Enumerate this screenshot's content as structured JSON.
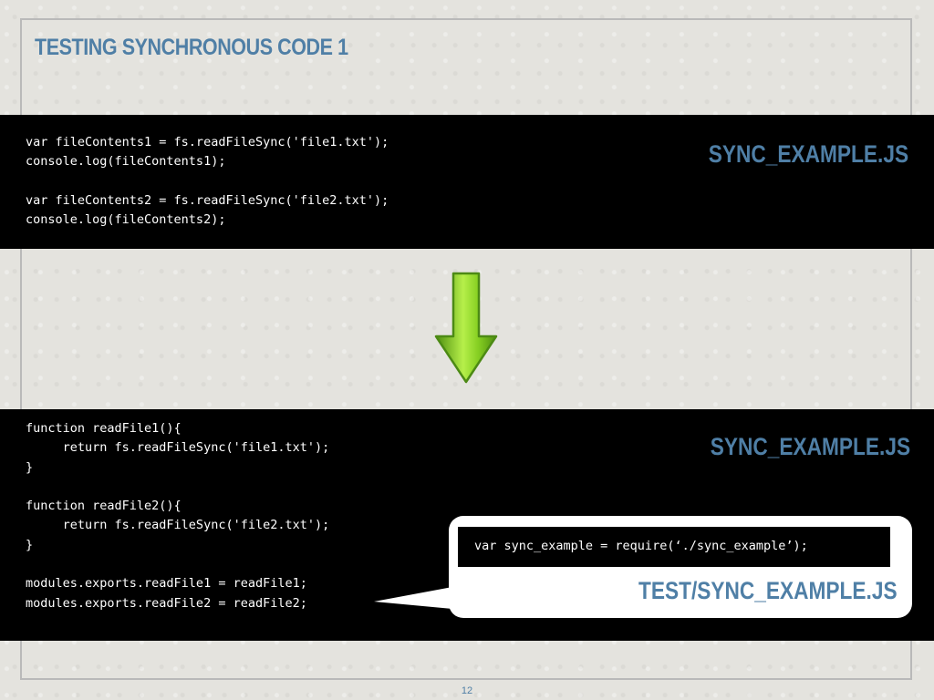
{
  "slide": {
    "title": "TESTING SYNCHRONOUS CODE 1",
    "page_number": "12"
  },
  "top_panel": {
    "code": "var fileContents1 = fs.readFileSync('file1.txt');\nconsole.log(fileContents1);\n\nvar fileContents2 = fs.readFileSync('file2.txt');\nconsole.log(fileContents2);",
    "file_label": "SYNC_EXAMPLE.JS"
  },
  "bottom_panel": {
    "code": "function readFile1(){\n     return fs.readFileSync('file1.txt');\n}\n\nfunction readFile2(){\n     return fs.readFileSync('file2.txt');\n}\n\nmodules.exports.readFile1 = readFile1;\nmodules.exports.readFile2 = readFile2;",
    "file_label": "SYNC_EXAMPLE.JS"
  },
  "callout": {
    "code": "var sync_example = require(‘./sync_example’);",
    "file_label": "TEST/SYNC_EXAMPLE.JS"
  },
  "colors": {
    "accent": "#4f7fa6",
    "arrow_green": "#7cc41e",
    "code_background": "#000000"
  },
  "icons": {
    "arrow": "down-arrow-icon"
  }
}
